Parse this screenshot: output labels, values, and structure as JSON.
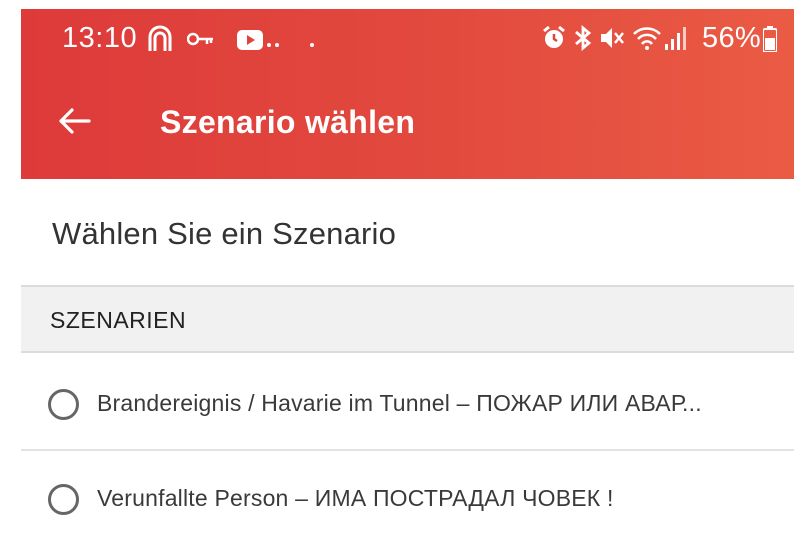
{
  "status_bar": {
    "time": "13:10",
    "battery_percent": "56%",
    "icons_left": [
      "arch-icon",
      "key-icon",
      "youtube-icon",
      "more-dots-icon"
    ],
    "icons_right": [
      "alarm-icon",
      "bluetooth-icon",
      "mute-icon",
      "wifi-icon",
      "signal-icon",
      "battery-icon"
    ]
  },
  "app_bar": {
    "title": "Szenario wählen",
    "back_icon": "arrow-left-icon",
    "color": "#e2443d"
  },
  "main": {
    "subtitle": "Wählen Sie ein Szenario",
    "section_header": "SZENARIEN",
    "options": [
      {
        "label": "Brandereignis / Havarie im Tunnel – ПОЖАР ИЛИ АВАР...",
        "selected": false
      },
      {
        "label": "Verunfallte Person – ИМА ПОСТРАДАЛ ЧОВЕК !",
        "selected": false
      }
    ]
  }
}
